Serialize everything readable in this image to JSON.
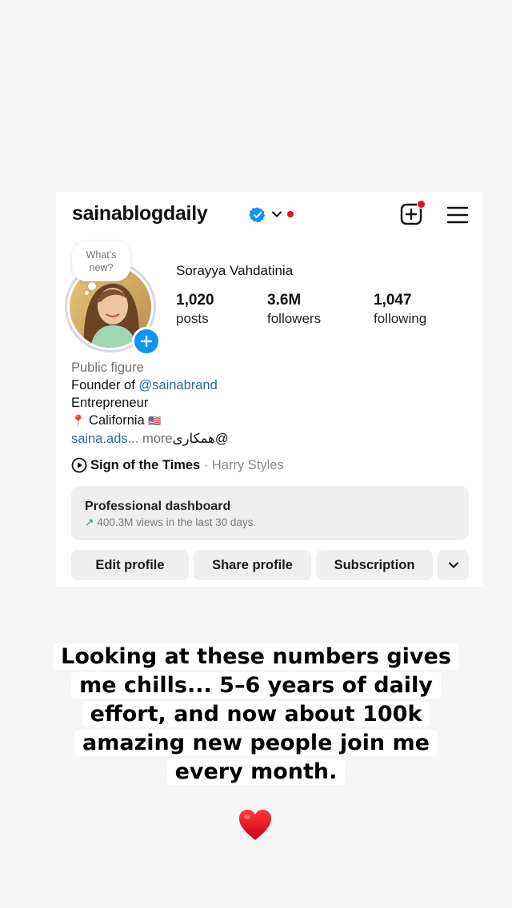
{
  "profile": {
    "username": "sainablogdaily",
    "full_name": "Sorayya Vahdatinia",
    "note": "What's new?",
    "stats": [
      {
        "value": "1,020",
        "label": "posts"
      },
      {
        "value": "3.6M",
        "label": "followers"
      },
      {
        "value": "1,047",
        "label": "following"
      }
    ],
    "bio": {
      "category": "Public figure",
      "line1_prefix": "Founder of ",
      "line1_mention": "@sainabrand",
      "line2": "Entrepreneur",
      "location_pin": "📍",
      "location": "California",
      "flag": "🇺🇸",
      "link": "saina.ads",
      "more": "... more",
      "mention_rtl": "@همکاری"
    },
    "music": {
      "song": "Sign of the Times",
      "separator": " · ",
      "artist": "Harry Styles"
    },
    "dashboard": {
      "title": "Professional dashboard",
      "arrow": "↗",
      "subtitle": "400.3M views in the last 30 days."
    },
    "buttons": {
      "edit": "Edit profile",
      "share": "Share profile",
      "subscription": "Subscription"
    }
  },
  "caption": {
    "lines": [
      "Looking at these numbers gives",
      "me chills... 5–6 years of daily",
      "effort, and now about 100k",
      "amazing new people join me",
      "every month."
    ]
  },
  "colors": {
    "accent_blue": "#0a95f6",
    "notification_red": "#e1112a",
    "link": "#2c6aa0",
    "button_bg": "#efeff0",
    "trend_green": "#1c8f5a"
  },
  "icons": {
    "verified": "verified-badge-icon",
    "chevron": "chevron-down-icon",
    "create": "plus-square-icon",
    "menu": "hamburger-menu-icon",
    "play": "play-circle-icon",
    "heart": "red-heart-icon"
  }
}
